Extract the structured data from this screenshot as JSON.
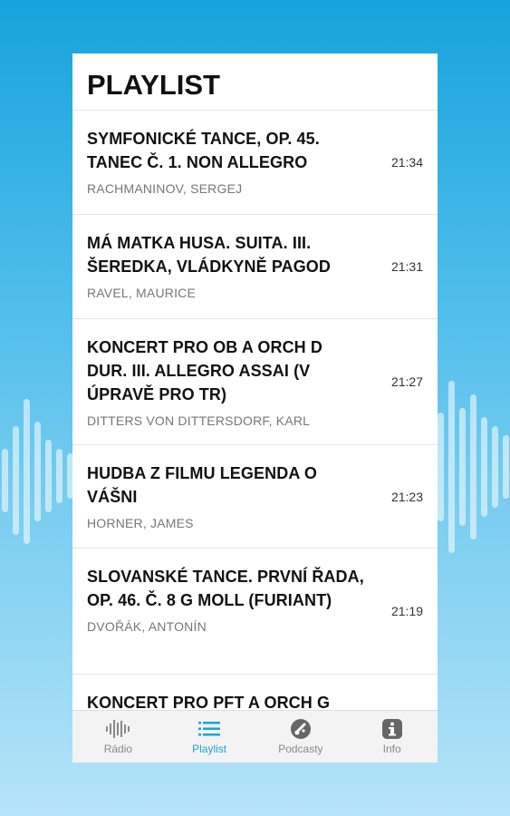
{
  "header": {
    "title": "PLAYLIST"
  },
  "playlist": [
    {
      "track": "SYMFONICKÉ TANCE, OP. 45. TANEC Č. 1. NON ALLEGRO",
      "artist": "RACHMANINOV, SERGEJ",
      "time": "21:34"
    },
    {
      "track": "MÁ MATKA HUSA. SUITA. III. ŠEREDKA, VLÁDKYNĚ PAGOD",
      "artist": "RAVEL, MAURICE",
      "time": "21:31"
    },
    {
      "track": "KONCERT PRO OB A ORCH D DUR. III. ALLEGRO ASSAI (V ÚPRAVĚ PRO TR)",
      "artist": "DITTERS VON DITTERSDORF, KARL",
      "time": "21:27"
    },
    {
      "track": "HUDBA Z FILMU LEGENDA O VÁŠNI",
      "artist": "HORNER, JAMES",
      "time": "21:23"
    },
    {
      "track": "SLOVANSKÉ TANCE. PRVNÍ ŘADA, OP. 46. Č. 8 G MOLL (FURIANT)",
      "artist": "DVOŘÁK, ANTONÍN",
      "time": "21:19"
    },
    {
      "track": "KONCERT PRO PFT A ORCH G",
      "artist": "",
      "time": ""
    }
  ],
  "tabs": [
    {
      "label": "Rádio",
      "icon": "radio-wave-icon",
      "active": false
    },
    {
      "label": "Playlist",
      "icon": "list-icon",
      "active": true
    },
    {
      "label": "Podcasty",
      "icon": "podcast-icon",
      "active": false
    },
    {
      "label": "Info",
      "icon": "info-icon",
      "active": false
    }
  ],
  "colors": {
    "accent": "#1aa3d9",
    "background_top": "#17a3dc",
    "background_bottom": "#b5e4f8"
  }
}
